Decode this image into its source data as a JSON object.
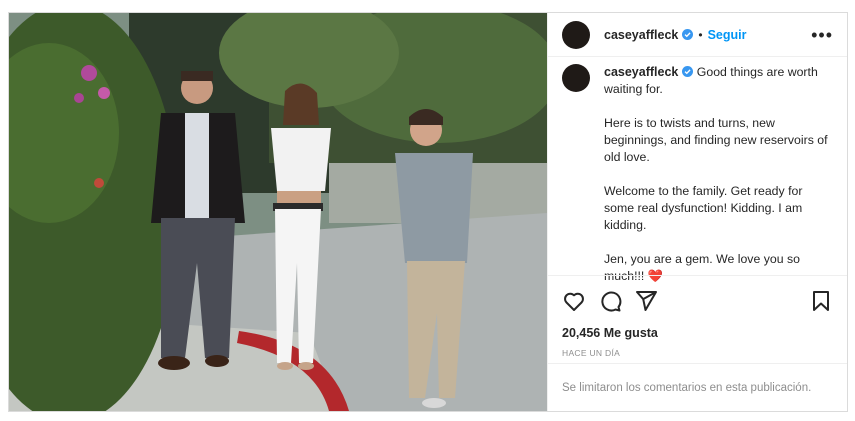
{
  "post": {
    "username": "caseyaffleck",
    "follow_label": "Seguir",
    "separator": "•",
    "more_label": "•••",
    "caption_paragraphs": [
      "Good things are worth waiting for.",
      "Here is to twists and turns, new beginnings, and finding new reservoirs of old love.",
      "Welcome to the family. Get ready for some real dysfunction! Kidding. I am kidding.",
      "Jen, you are a gem. We love you so much!!!"
    ],
    "caption_emoji": "❤️",
    "likes_text": "20,456 Me gusta",
    "timestamp": "Hace un día",
    "comments_disabled": "Se limitaron los comentarios en esta publicación."
  },
  "colors": {
    "follow_blue": "#0095f6",
    "verified_blue": "#3897f0",
    "muted_text": "#8e8e8e",
    "heart_red": "#ed4956"
  },
  "icons": [
    "verified-badge-icon",
    "more-options-icon",
    "heart-icon",
    "comment-icon",
    "share-icon",
    "bookmark-icon"
  ]
}
